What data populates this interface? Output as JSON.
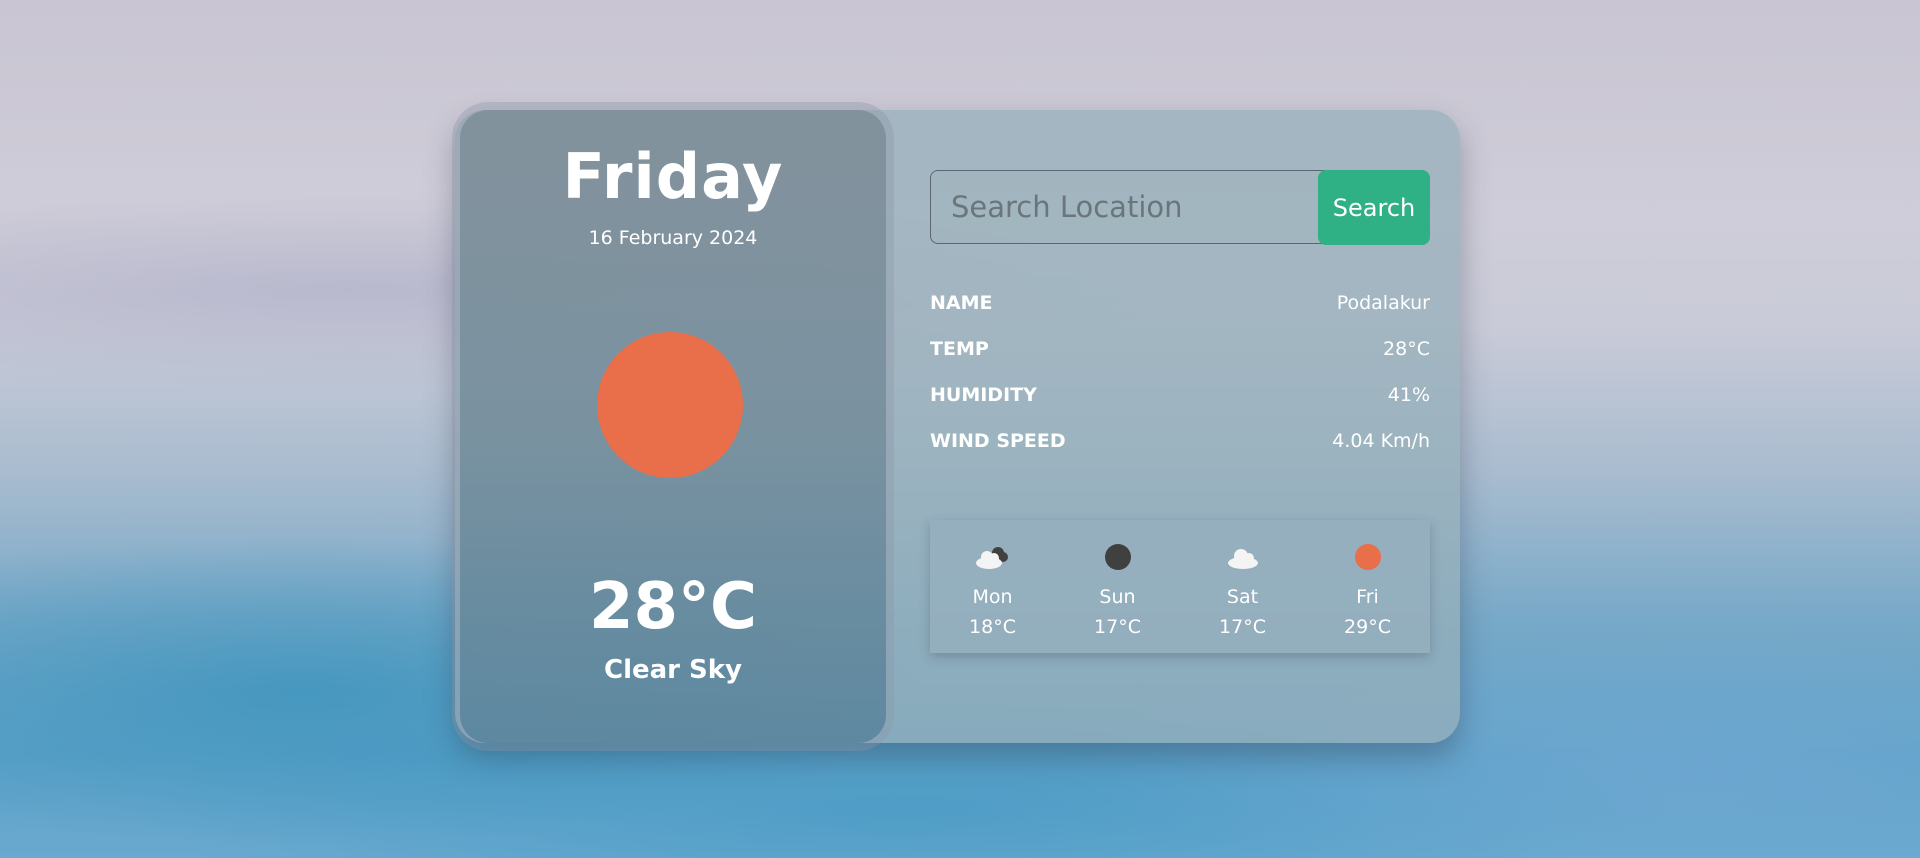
{
  "current": {
    "day": "Friday",
    "date": "16 February 2024",
    "temp": "28°C",
    "condition": "Clear Sky",
    "icon": "sun-icon"
  },
  "search": {
    "placeholder": "Search Location",
    "value": "",
    "button_label": "Search"
  },
  "details": [
    {
      "label": "NAME",
      "value": "Podalakur"
    },
    {
      "label": "TEMP",
      "value": "28°C"
    },
    {
      "label": "HUMIDITY",
      "value": "41%"
    },
    {
      "label": "WIND SPEED",
      "value": "4.04 Km/h"
    }
  ],
  "forecast": [
    {
      "day": "Mon",
      "temp": "18°C",
      "icon": "cloudy-icon"
    },
    {
      "day": "Sun",
      "temp": "17°C",
      "icon": "moon-icon"
    },
    {
      "day": "Sat",
      "temp": "17°C",
      "icon": "cloud-icon"
    },
    {
      "day": "Fri",
      "temp": "29°C",
      "icon": "sun-icon"
    }
  ],
  "colors": {
    "accent": "#2fb185",
    "sun": "#e96e4a",
    "moon": "#404040"
  }
}
